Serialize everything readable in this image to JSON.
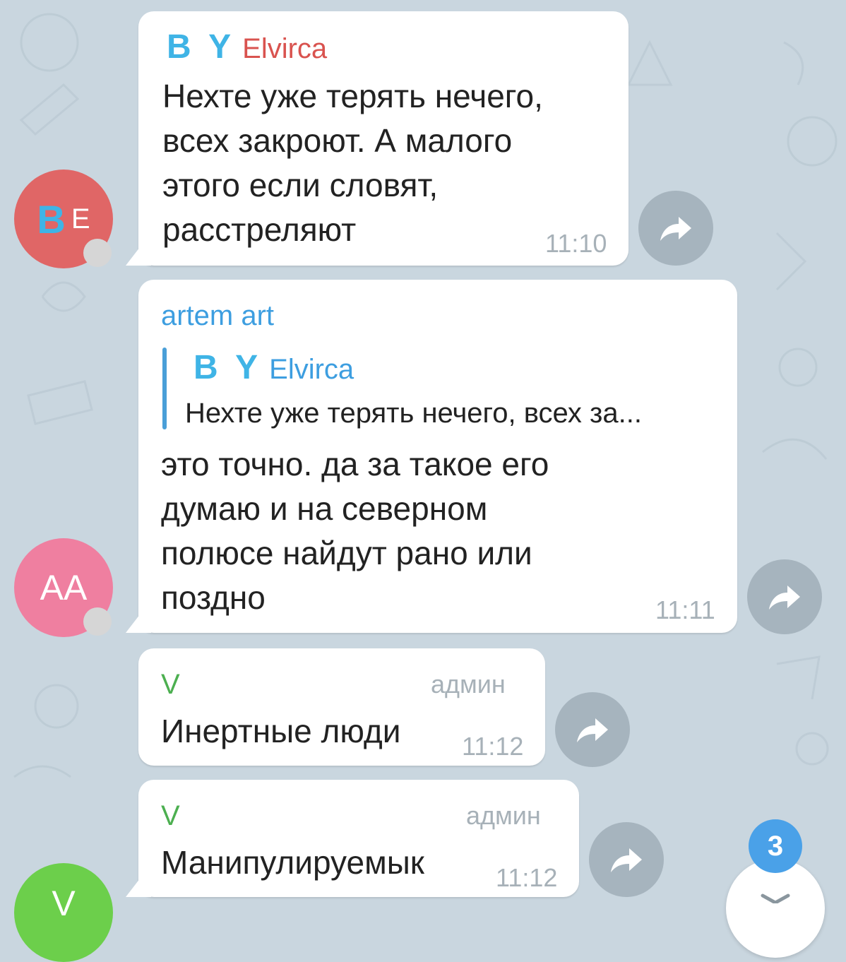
{
  "colors": {
    "background": "#c9d6df",
    "elvirca_name_color": "#d9534f",
    "quoted_name_color": "#3d9ee0",
    "artem_name_color": "#3d9ee0",
    "v_name_color": "#4caf50",
    "avatar_be": "#e06666",
    "avatar_aa": "#ef7fa0",
    "avatar_v": "#6ccf4b",
    "badge": "#4aa1e8"
  },
  "messages": [
    {
      "sender_logo": "B Y",
      "sender_name": "Elvirca",
      "lines": [
        "Нехте уже терять нечего,",
        "всех закроют. А малого",
        "этого если словят,",
        "расстреляют"
      ],
      "time": "11:10",
      "avatar_logo": "B",
      "avatar_letter": "E"
    },
    {
      "sender_name": "artem art",
      "reply": {
        "sender_logo": "B Y",
        "sender_name": "Elvirca",
        "preview": "Нехте уже терять нечего, всех за..."
      },
      "lines": [
        "это точно. да за такое его",
        "думаю и на северном",
        "полюсе найдут рано или",
        "поздно"
      ],
      "time": "11:11",
      "avatar_initials": "AA"
    },
    {
      "sender_name": "V",
      "role": "админ",
      "lines": [
        "Инертные люди"
      ],
      "time": "11:12"
    },
    {
      "sender_name": "V",
      "role": "админ",
      "lines": [
        "Манипулируемык"
      ],
      "time": "11:12",
      "avatar_initials": "V"
    }
  ],
  "unread_badge": "3",
  "icons": {
    "share": "share-arrow-icon",
    "scroll_down": "chevron-down-icon"
  }
}
